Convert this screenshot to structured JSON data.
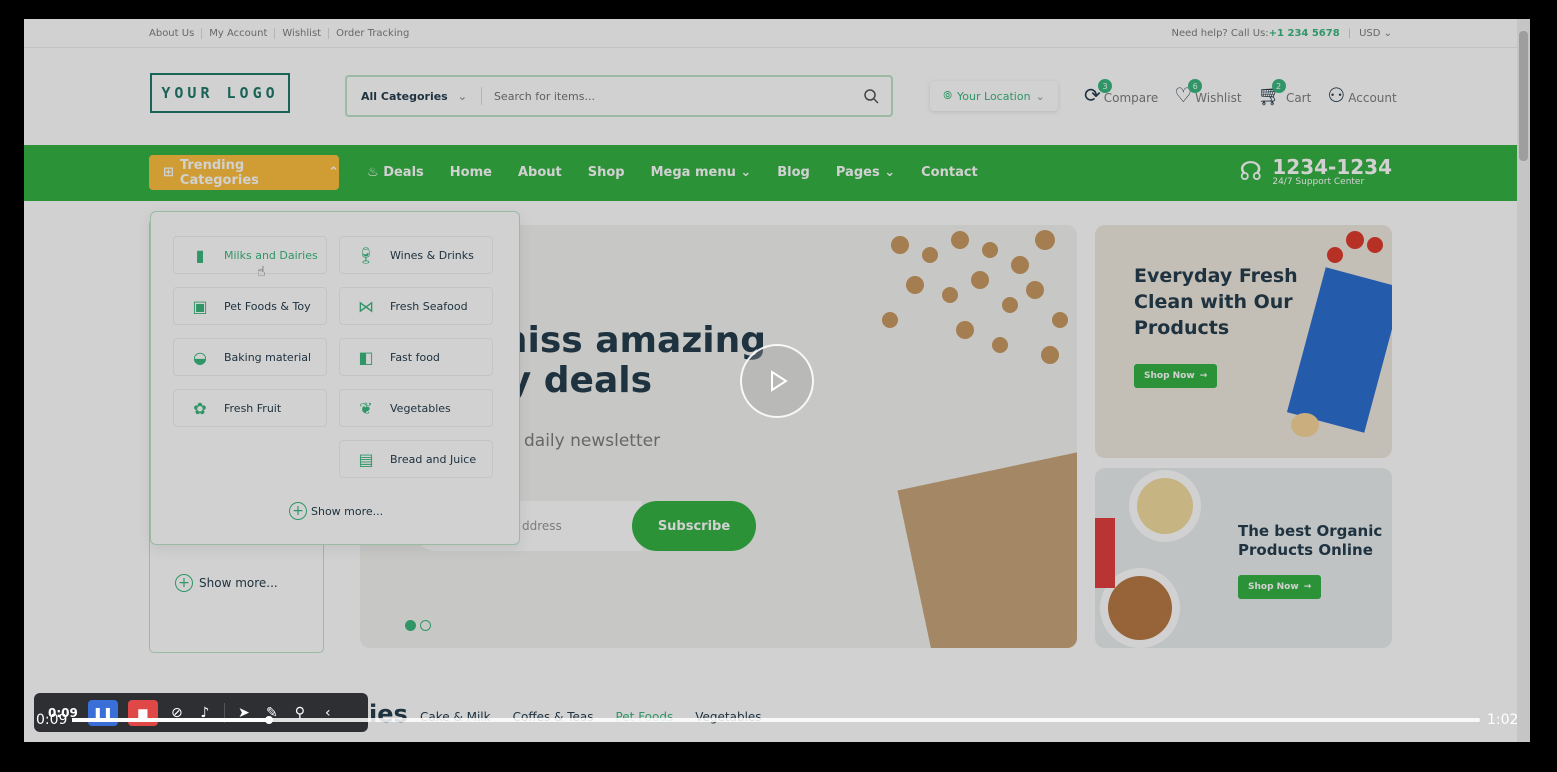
{
  "topbar": {
    "links": [
      "About Us",
      "My Account",
      "Wishlist",
      "Order Tracking"
    ],
    "help_label": "Need help? Call Us:",
    "phone": "+1 234 5678",
    "currency": "USD"
  },
  "header": {
    "logo": "YOUR LOGO",
    "search_category": "All Categories",
    "search_placeholder": "Search for items...",
    "location": "Your Location",
    "icons": [
      {
        "label": "Compare",
        "count": "3",
        "icon": "compare-icon"
      },
      {
        "label": "Wishlist",
        "count": "6",
        "icon": "heart-icon"
      },
      {
        "label": "Cart",
        "count": "2",
        "icon": "cart-icon"
      },
      {
        "label": "Account",
        "count": "",
        "icon": "user-icon"
      }
    ]
  },
  "nav": {
    "trending": "Trending Categories",
    "deals": "Deals",
    "links": [
      "Home",
      "About",
      "Shop",
      "Mega menu",
      "Blog",
      "Pages",
      "Contact"
    ],
    "support_number": "1234-1234",
    "support_label": "24/7 Support Center"
  },
  "dropdown": {
    "items": [
      {
        "label": "Milks and Dairies",
        "icon": "milk-icon"
      },
      {
        "label": "Wines & Drinks",
        "icon": "wine-icon"
      },
      {
        "label": "Pet Foods & Toy",
        "icon": "pet-food-icon"
      },
      {
        "label": "Fresh Seafood",
        "icon": "fish-icon"
      },
      {
        "label": "Baking material",
        "icon": "baking-icon"
      },
      {
        "label": "Fast food",
        "icon": "fast-food-icon"
      },
      {
        "label": "Fresh Fruit",
        "icon": "fruit-icon"
      },
      {
        "label": "Vegetables",
        "icon": "vegetables-icon"
      },
      {
        "label": "Bread and Juice",
        "icon": "bread-icon"
      }
    ],
    "show_more": "Show more..."
  },
  "sidepanel": {
    "show_more": "Show more..."
  },
  "hero": {
    "headline_line1": "miss amazing",
    "headline_line2": "ry deals",
    "subtitle": "daily newsletter",
    "email_placeholder": "ddress",
    "subscribe": "Subscribe"
  },
  "banners": {
    "b1_title": "Everyday Fresh Clean with Our Products",
    "b1_button": "Shop Now",
    "b2_title": "The best Organic Products Online",
    "b2_button": "Shop Now"
  },
  "popular": {
    "heading_fragment": "ies",
    "tabs": [
      "Cake & Milk",
      "Coffes & Teas",
      "Pet Foods",
      "Vegetables"
    ],
    "active_tab": "Pet Foods"
  },
  "video": {
    "current_time": "0:09",
    "duration": "1:02",
    "recorder_time": "0:09",
    "progress": 0.14
  },
  "colors": {
    "brand_green": "#35b345",
    "accent_yellow": "#fdc040",
    "text_dark": "#253d4e"
  }
}
